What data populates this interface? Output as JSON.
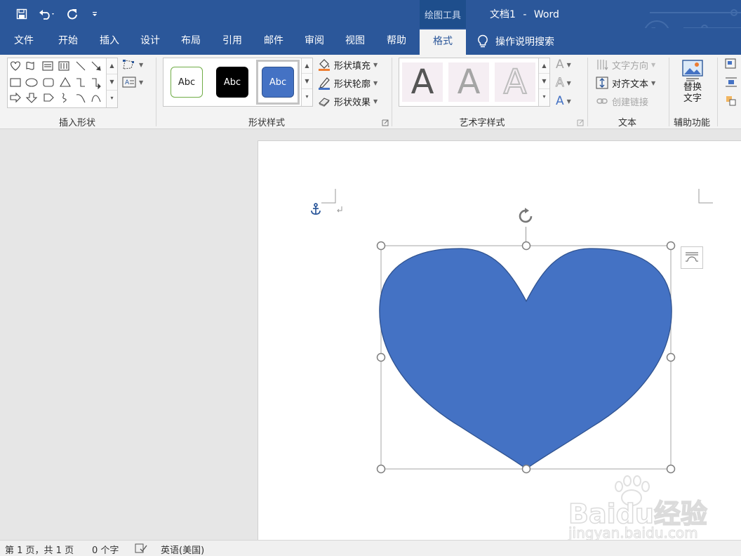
{
  "window": {
    "contextual_tab": "绘图工具",
    "doc_name": "文档1",
    "title_separator": "-",
    "app_name": "Word"
  },
  "qat": {
    "items": [
      "save-icon",
      "undo-icon",
      "redo-icon",
      "customize-icon"
    ]
  },
  "tabs": [
    "文件",
    "开始",
    "插入",
    "设计",
    "布局",
    "引用",
    "邮件",
    "审阅",
    "视图",
    "帮助",
    "格式"
  ],
  "active_tab": "格式",
  "tell_me": "操作说明搜索",
  "ribbon": {
    "insert_shapes": {
      "label": "插入形状"
    },
    "shape_styles": {
      "label": "形状样式",
      "presets": [
        "Abc",
        "Abc",
        "Abc"
      ],
      "fill": "形状填充",
      "outline": "形状轮廓",
      "effects": "形状效果"
    },
    "wordart_styles": {
      "label": "艺术字样式",
      "letter": "A"
    },
    "text": {
      "label": "文本",
      "direction": "文字方向",
      "align": "对齐文本",
      "link": "创建链接"
    },
    "accessibility": {
      "label": "辅助功能",
      "alt_text_line1": "替换",
      "alt_text_line2": "文字"
    }
  },
  "status": {
    "page": "第 1 页，共 1 页",
    "words": "0 个字",
    "language": "英语(美国)"
  },
  "watermark": {
    "brand": "Baidu经验",
    "url": "jingyan.baidu.com"
  },
  "colors": {
    "ribbon_blue": "#2b579a",
    "heart_fill": "#4472c4",
    "heart_outline": "#2f528f"
  }
}
